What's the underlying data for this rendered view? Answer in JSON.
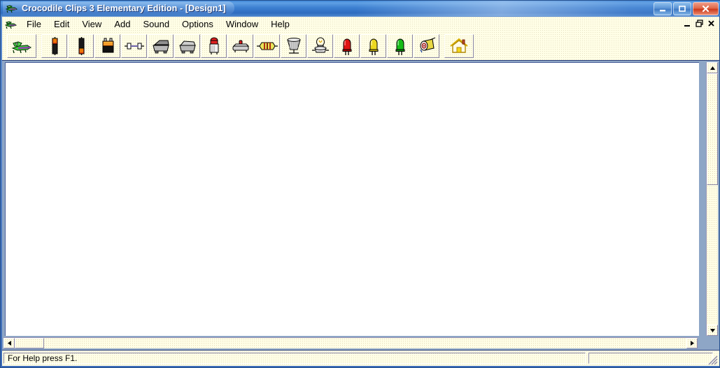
{
  "window": {
    "title": "Crocodile Clips 3 Elementary Edition - [Design1]",
    "app_icon": "crocodile-icon",
    "controls": {
      "minimize": "minimize-icon",
      "maximize": "maximize-icon",
      "close": "close-icon"
    },
    "mdi_controls": {
      "minimize": "mdi-minimize-icon",
      "restore": "mdi-restore-icon",
      "close": "mdi-close-icon"
    }
  },
  "menu": {
    "icon": "crocodile-icon",
    "items": [
      {
        "label": "File"
      },
      {
        "label": "Edit"
      },
      {
        "label": "View"
      },
      {
        "label": "Add"
      },
      {
        "label": "Sound"
      },
      {
        "label": "Options"
      },
      {
        "label": "Window"
      },
      {
        "label": "Help"
      }
    ]
  },
  "toolbar": {
    "buttons": [
      {
        "name": "crocodile-tool-button",
        "icon": "crocodile-icon",
        "group": 0
      },
      {
        "name": "battery-cell-button",
        "icon": "battery-cell-icon",
        "group": 1
      },
      {
        "name": "battery-cell-reversed-button",
        "icon": "battery-cell-reversed-icon",
        "group": 1
      },
      {
        "name": "battery-pack-button",
        "icon": "battery-pack-icon",
        "group": 1
      },
      {
        "name": "fuse-button",
        "icon": "fuse-icon",
        "group": 1
      },
      {
        "name": "switch-button",
        "icon": "switch-icon",
        "group": 1
      },
      {
        "name": "switch-closed-button",
        "icon": "switch-closed-icon",
        "group": 1
      },
      {
        "name": "push-switch-button",
        "icon": "push-switch-icon",
        "group": 1
      },
      {
        "name": "push-to-make-button",
        "icon": "push-to-make-icon",
        "group": 1
      },
      {
        "name": "resistor-button",
        "icon": "resistor-icon",
        "group": 1
      },
      {
        "name": "buzzer-button",
        "icon": "buzzer-icon",
        "group": 1
      },
      {
        "name": "lamp-button",
        "icon": "lamp-icon",
        "group": 1
      },
      {
        "name": "led-red-button",
        "icon": "led-red-icon",
        "group": 1
      },
      {
        "name": "led-yellow-button",
        "icon": "led-yellow-icon",
        "group": 1
      },
      {
        "name": "led-green-button",
        "icon": "led-green-icon",
        "group": 1
      },
      {
        "name": "motor-button",
        "icon": "motor-icon",
        "group": 1
      },
      {
        "name": "home-button",
        "icon": "home-icon",
        "group": 2
      }
    ]
  },
  "document": {
    "canvas_name": "design-canvas",
    "scrollbars": {
      "vertical": {
        "up": "scroll-up-icon",
        "down": "scroll-down-icon"
      },
      "horizontal": {
        "left": "scroll-left-icon",
        "right": "scroll-right-icon"
      }
    }
  },
  "statusbar": {
    "message": "For Help press F1.",
    "secondary": ""
  },
  "colors": {
    "title_blue": "#3c7fd0",
    "menu_bg": "#fffee6",
    "canvas": "#ffffff",
    "frame_blue": "#3d6cb8",
    "led_red": "#e02020",
    "led_yellow": "#ecd820",
    "led_green": "#18c018",
    "croc_green": "#2fc22f"
  }
}
